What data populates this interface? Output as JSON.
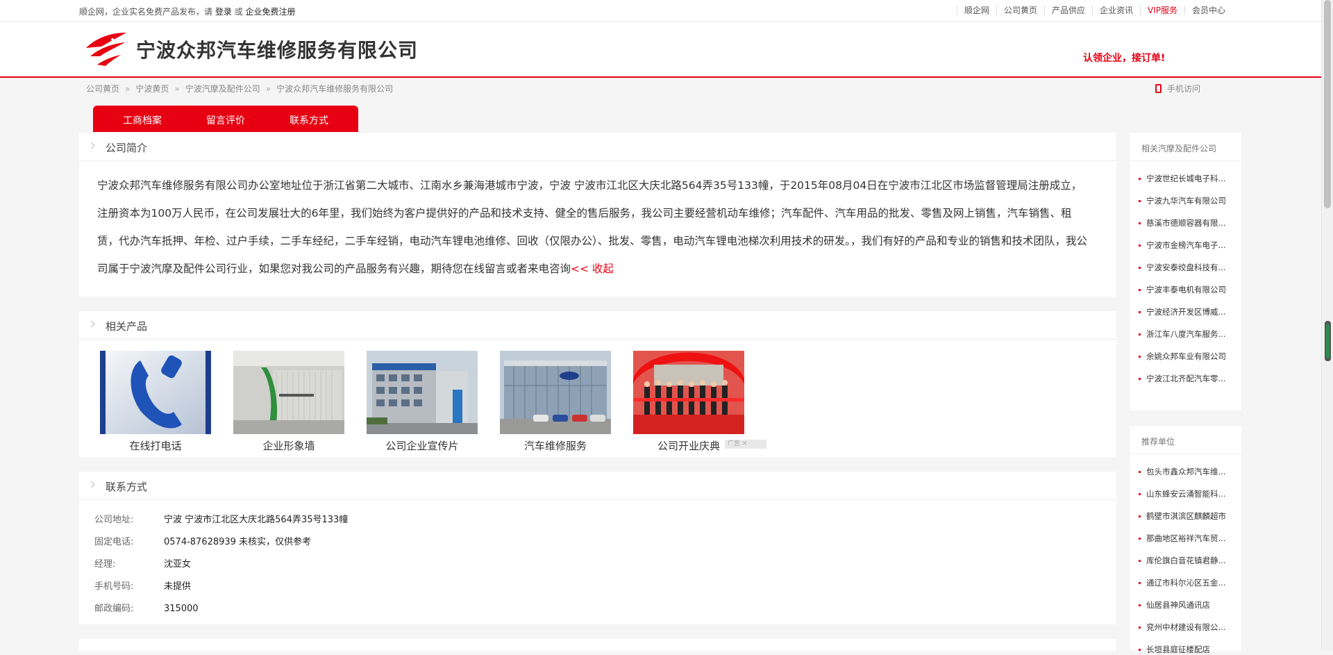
{
  "topbar": {
    "intro": "顺企网，企业实名免费产品发布，请",
    "login": "登录",
    "or": "或",
    "register": "企业免费注册",
    "links": [
      "顺企网",
      "公司黄页",
      "产品供应",
      "企业资讯",
      "VIP服务",
      "会员中心"
    ]
  },
  "header": {
    "company": "宁波众邦汽车维修服务有限公司",
    "slogan": "认领企业，接订单!"
  },
  "breadcrumb": [
    "公司黄页",
    "宁波黄页",
    "宁波汽摩及配件公司",
    "宁波众邦汽车维修服务有限公司"
  ],
  "mobile_label": "手机访问",
  "tabs": [
    "工商档案",
    "留言评价",
    "联系方式"
  ],
  "intro": {
    "title": "公司简介",
    "text": "宁波众邦汽车维修服务有限公司办公室地址位于浙江省第二大城市、江南水乡兼海港城市宁波，宁波 宁波市江北区大庆北路564弄35号133幢，于2015年08月04日在宁波市江北区市场监督管理局注册成立，注册资本为100万人民币，在公司发展壮大的6年里，我们始终为客户提供好的产品和技术支持、健全的售后服务，我公司主要经营机动车维修；汽车配件、汽车用品的批发、零售及网上销售，汽车销售、租赁，代办汽车抵押、年检、过户手续，二手车经纪，二手车经销，电动汽车锂电池维修、回收（仅限办公）、批发、零售，电动汽车锂电池梯次利用技术的研发。，我们有好的产品和专业的销售和技术团队，我公司属于宁波汽摩及配件公司行业，如果您对我公司的产品服务有兴趣，期待您在线留言或者来电咨询",
    "collapse": "<< 收起"
  },
  "products": {
    "title": "相关产品",
    "items": [
      "在线打电话",
      "企业形象墙",
      "公司企业宣传片",
      "汽车维修服务",
      "公司开业庆典"
    ],
    "ad": "广告"
  },
  "contact": {
    "title": "联系方式",
    "rows": [
      {
        "label": "公司地址:",
        "value": "宁波 宁波市江北区大庆北路564弄35号133幢"
      },
      {
        "label": "固定电话:",
        "value": "0574-87628939 未核实，仅供参考"
      },
      {
        "label": "经理:",
        "value": "沈亚女"
      },
      {
        "label": "手机号码:",
        "value": "未提供"
      },
      {
        "label": "邮政编码:",
        "value": "315000"
      }
    ]
  },
  "sidebar_related": {
    "title": "相关汽摩及配件公司",
    "items": [
      "宁波世纪长城电子科...",
      "宁波九华汽车有限公司",
      "慈溪市德顺容器有限...",
      "宁波市金榜汽车电子...",
      "宁波安泰绞盘科技有...",
      "宁波丰泰电机有限公司",
      "宁波经济开发区博威...",
      "浙江车八度汽车服务...",
      "余姚众邦车业有限公司",
      "宁波江北齐配汽车零..."
    ]
  },
  "sidebar_recommended": {
    "title": "推荐单位",
    "items": [
      "包头市鑫众邦汽车维...",
      "山东蜂安云涌智能科...",
      "鹤壁市淇滨区麒麟超市",
      "那曲地区裕祥汽车贸...",
      "库伦旗白音花镇君静...",
      "通辽市科尔沁区五金...",
      "仙居县神风通讯店",
      "兖州中材建设有限公...",
      "长垣县庭征楼配店"
    ]
  },
  "colors": {
    "brand": "#e60012",
    "background": "#f5f5f5"
  }
}
